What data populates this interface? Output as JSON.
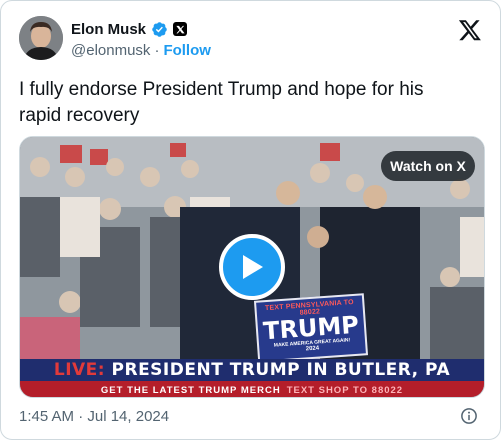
{
  "author": {
    "display_name": "Elon Musk",
    "handle": "@elonmusk",
    "separator": "·",
    "follow_label": "Follow"
  },
  "tweet": {
    "text": "I fully endorse President Trump and hope for his rapid recovery",
    "timestamp": "1:45 AM · Jul 14, 2024"
  },
  "media": {
    "watch_label": "Watch on X",
    "sign": {
      "top_text": "TEXT PENNSYLVANIA TO 88022",
      "main_text": "TRUMP",
      "sub_text": "MAKE AMERICA GREAT AGAIN!",
      "year": "2024"
    },
    "banner": {
      "live": "LIVE:",
      "text": "PRESIDENT TRUMP IN BUTLER, PA"
    },
    "ticker": {
      "left": "GET THE LATEST TRUMP MERCH",
      "right": "TEXT SHOP TO 88022"
    }
  },
  "colors": {
    "accent": "#1d9bf0",
    "text": "#0f1419",
    "muted": "#536471"
  },
  "icons": {
    "verified": "verified-badge-icon",
    "affiliate": "x-affiliate-icon",
    "logo": "x-logo-icon",
    "play": "play-icon",
    "info": "info-icon"
  }
}
